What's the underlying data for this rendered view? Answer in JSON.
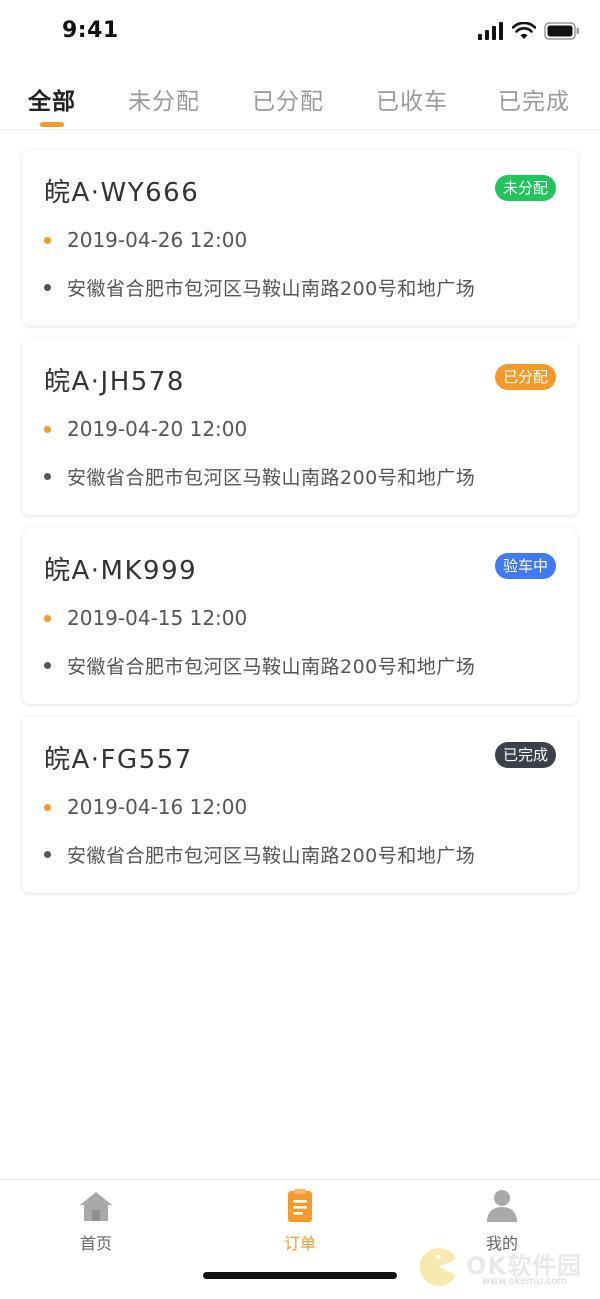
{
  "status_bar": {
    "time": "9:41"
  },
  "tabs": [
    {
      "label": "全部",
      "active": true
    },
    {
      "label": "未分配",
      "active": false
    },
    {
      "label": "已分配",
      "active": false
    },
    {
      "label": "已收车",
      "active": false
    },
    {
      "label": "已完成",
      "active": false
    }
  ],
  "orders": [
    {
      "plate": "皖A·WY666",
      "status": "未分配",
      "status_color": "#21c55d",
      "time": "2019-04-26 12:00",
      "address": "安徽省合肥市包河区马鞍山南路200号和地广场"
    },
    {
      "plate": "皖A·JH578",
      "status": "已分配",
      "status_color": "#f39a2b",
      "time": "2019-04-20 12:00",
      "address": "安徽省合肥市包河区马鞍山南路200号和地广场"
    },
    {
      "plate": "皖A·MK999",
      "status": "验车中",
      "status_color": "#3f7af0",
      "time": "2019-04-15 12:00",
      "address": "安徽省合肥市包河区马鞍山南路200号和地广场"
    },
    {
      "plate": "皖A·FG557",
      "status": "已完成",
      "status_color": "#3c4048",
      "time": "2019-04-16 12:00",
      "address": "安徽省合肥市包河区马鞍山南路200号和地广场"
    }
  ],
  "colors": {
    "accent": "#f39a2b",
    "time_dot": "#f39a2b",
    "address_dot": "#555555"
  },
  "bottom_nav": [
    {
      "label": "首页",
      "icon": "home-icon",
      "active": false
    },
    {
      "label": "订单",
      "icon": "orders-icon",
      "active": true
    },
    {
      "label": "我的",
      "icon": "user-icon",
      "active": false
    }
  ],
  "watermark": {
    "text": "OK软件园",
    "url": "www.okemu.com"
  }
}
